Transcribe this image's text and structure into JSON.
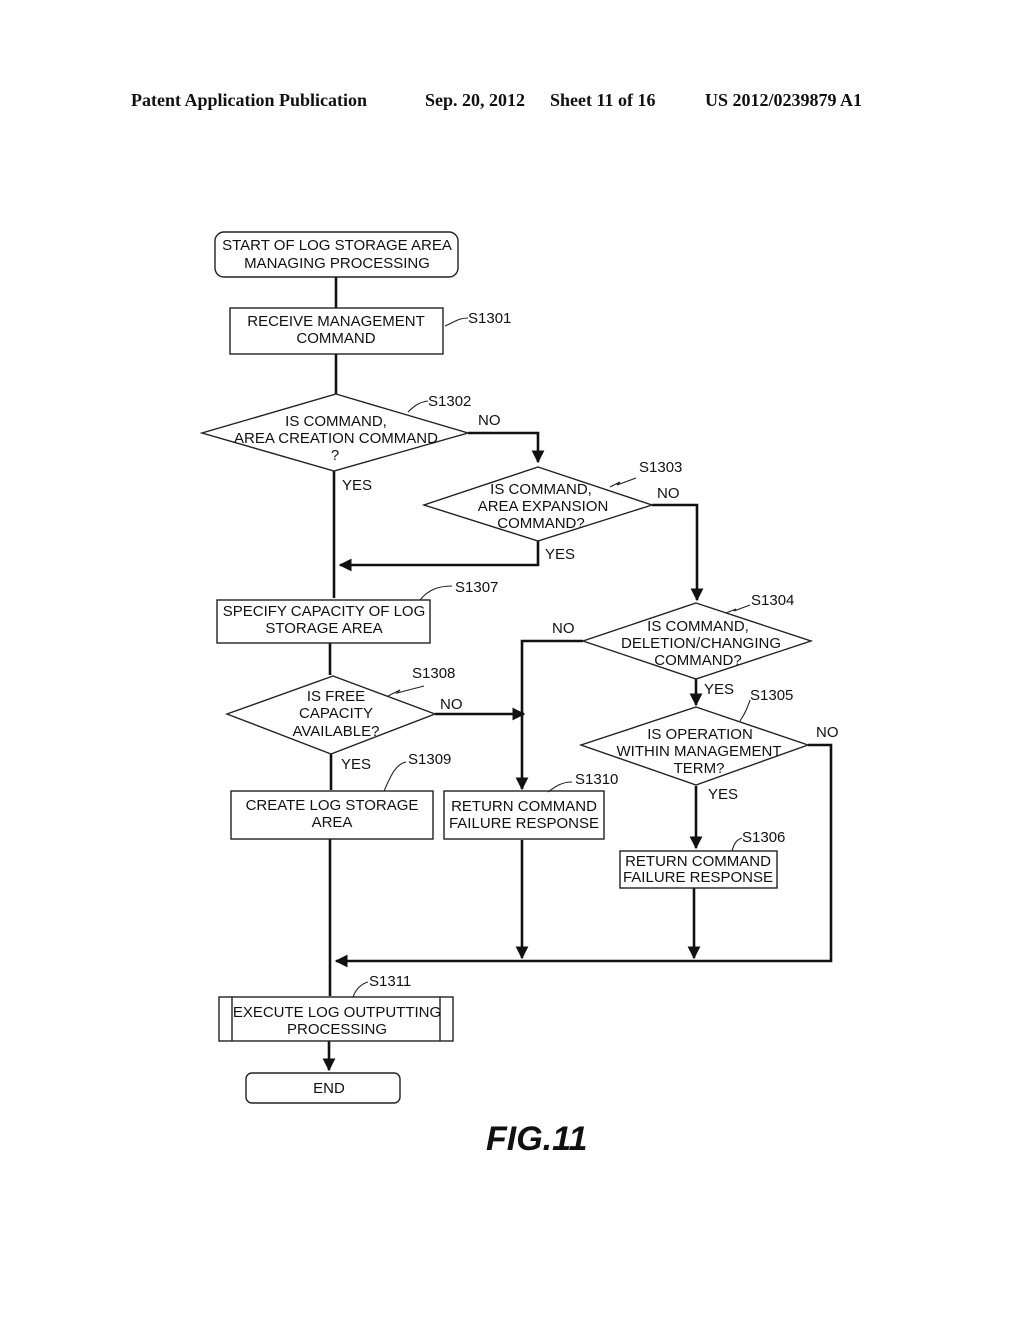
{
  "header": {
    "publication": "Patent Application Publication",
    "date": "Sep. 20, 2012",
    "sheet": "Sheet 11 of 16",
    "number": "US 2012/0239879 A1"
  },
  "figure_label": "FIG.11",
  "nodes": {
    "start": {
      "lines": [
        "START OF LOG STORAGE AREA",
        "MANAGING PROCESSING"
      ]
    },
    "s1301": {
      "ref": "S1301",
      "lines": [
        "RECEIVE MANAGEMENT",
        "COMMAND"
      ]
    },
    "s1302": {
      "ref": "S1302",
      "lines": [
        "IS COMMAND,",
        "AREA CREATION COMMAND",
        "?"
      ]
    },
    "s1303": {
      "ref": "S1303",
      "lines": [
        "IS COMMAND,",
        "AREA EXPANSION",
        "COMMAND?"
      ]
    },
    "s1304": {
      "ref": "S1304",
      "lines": [
        "IS COMMAND,",
        "DELETION/CHANGING",
        "COMMAND?"
      ]
    },
    "s1305": {
      "ref": "S1305",
      "lines": [
        "IS OPERATION",
        "WITHIN MANAGEMENT",
        "TERM?"
      ]
    },
    "s1306": {
      "ref": "S1306",
      "lines": [
        "RETURN COMMAND",
        "FAILURE RESPONSE"
      ]
    },
    "s1307": {
      "ref": "S1307",
      "lines": [
        "SPECIFY CAPACITY OF LOG",
        "STORAGE AREA"
      ]
    },
    "s1308": {
      "ref": "S1308",
      "lines": [
        "IS FREE",
        "CAPACITY",
        "AVAILABLE?"
      ]
    },
    "s1309": {
      "ref": "S1309",
      "lines": [
        "CREATE LOG STORAGE",
        "AREA"
      ]
    },
    "s1310": {
      "ref": "S1310",
      "lines": [
        "RETURN COMMAND",
        "FAILURE RESPONSE"
      ]
    },
    "s1311": {
      "ref": "S1311",
      "lines": [
        "EXECUTE LOG OUTPUTTING",
        "PROCESSING"
      ]
    },
    "end": {
      "lines": [
        "END"
      ]
    }
  },
  "branch_labels": {
    "s1302_no": "NO",
    "s1302_yes": "YES",
    "s1303_no": "NO",
    "s1303_yes": "YES",
    "s1304_no": "NO",
    "s1304_yes": "YES",
    "s1305_no": "NO",
    "s1305_yes": "YES",
    "s1308_no": "NO",
    "s1308_yes": "YES"
  }
}
